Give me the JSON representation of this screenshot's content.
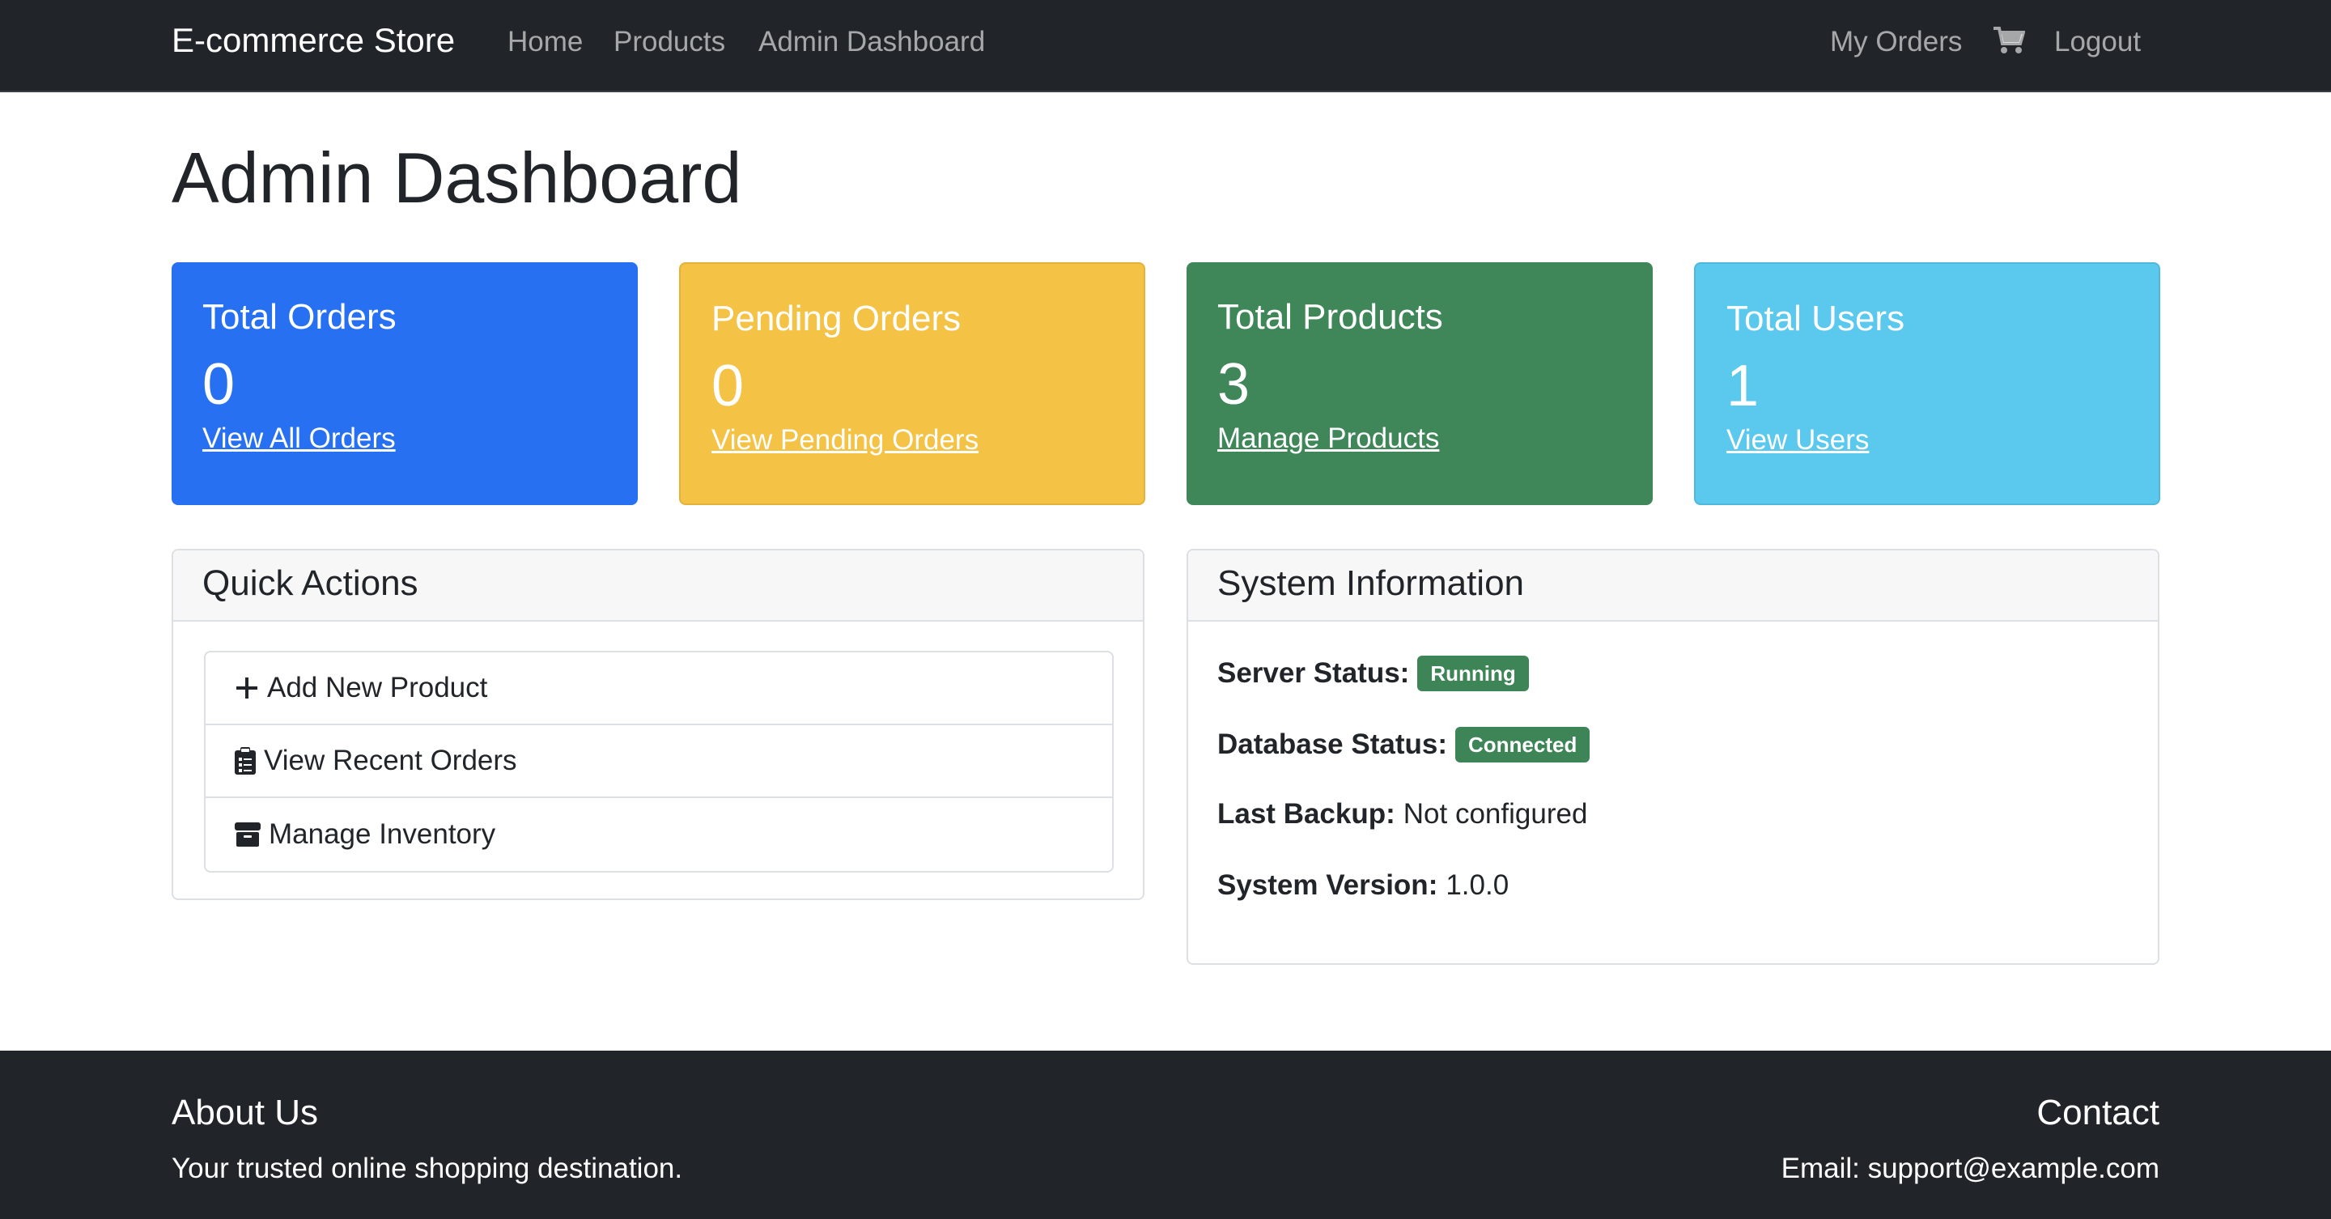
{
  "navbar": {
    "brand": "E-commerce Store",
    "links": [
      "Home",
      "Products",
      "Admin Dashboard"
    ],
    "my_orders": "My Orders",
    "logout": "Logout",
    "cart_icon": "shopping-cart-icon"
  },
  "page": {
    "title": "Admin Dashboard"
  },
  "cards": [
    {
      "title": "Total Orders",
      "value": "0",
      "link": "View All Orders",
      "color": "#2770f2"
    },
    {
      "title": "Pending Orders",
      "value": "0",
      "link": "View Pending Orders",
      "color": "#f4c244"
    },
    {
      "title": "Total Products",
      "value": "3",
      "link": "Manage Products",
      "color": "#3f8659"
    },
    {
      "title": "Total Users",
      "value": "1",
      "link": "View Users",
      "color": "#5bc8ee"
    }
  ],
  "quick_actions": {
    "title": "Quick Actions",
    "items": [
      {
        "label": "Add New Product",
        "icon": "plus-icon"
      },
      {
        "label": "View Recent Orders",
        "icon": "clipboard-list-icon"
      },
      {
        "label": "Manage Inventory",
        "icon": "box-icon"
      }
    ]
  },
  "system_info": {
    "title": "System Information",
    "server_label": "Server Status:",
    "server_value": "Running",
    "db_label": "Database Status:",
    "db_value": "Connected",
    "backup_label": "Last Backup:",
    "backup_value": "Not configured",
    "version_label": "System Version:",
    "version_value": "1.0.0",
    "badge_color": "#3d8557"
  },
  "footer": {
    "about_title": "About Us",
    "about_text": "Your trusted online shopping destination.",
    "contact_title": "Contact",
    "contact_text": "Email: support@example.com"
  }
}
